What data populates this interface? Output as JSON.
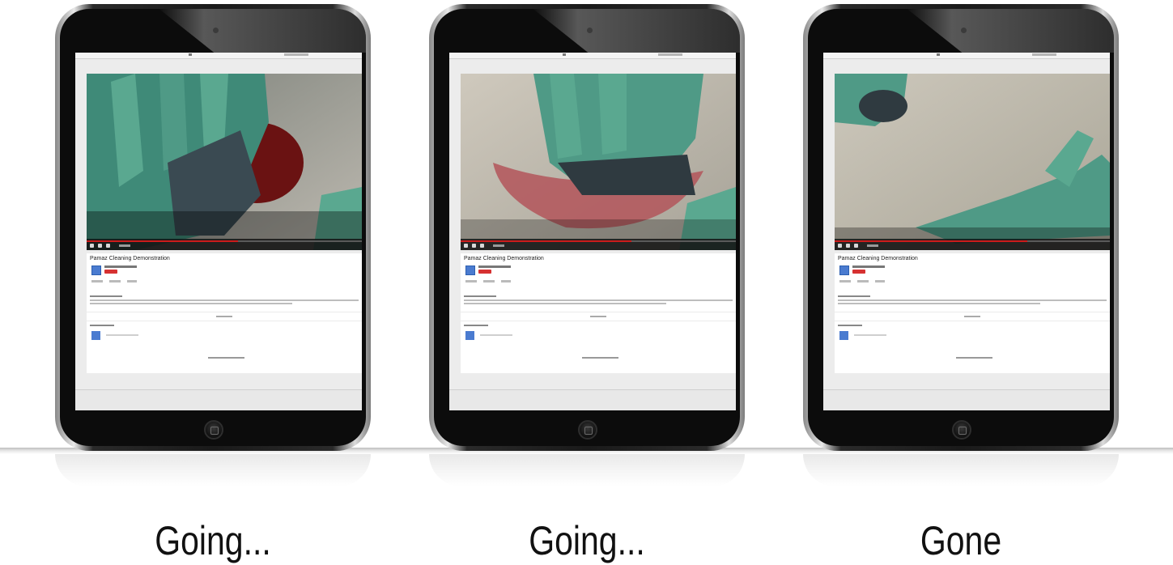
{
  "panels": [
    {
      "video_title": "Pamaz Cleaning Demonstration",
      "caption": "Going...",
      "stain": "large"
    },
    {
      "video_title": "Pamaz Cleaning Demonstration",
      "caption": "Going...",
      "stain": "smear"
    },
    {
      "video_title": "Pamaz Cleaning Demonstration",
      "caption": "Gone",
      "stain": "none"
    }
  ],
  "colors": {
    "glove": "#4f9a86",
    "stain": "#7a1414",
    "subscribe": "#d63131",
    "progress": "#cc1b1b",
    "avatar": "#4a7bd0"
  },
  "icons": [
    "play-icon",
    "volume-icon",
    "subscribe-icon",
    "home-button-icon",
    "camera-icon"
  ]
}
